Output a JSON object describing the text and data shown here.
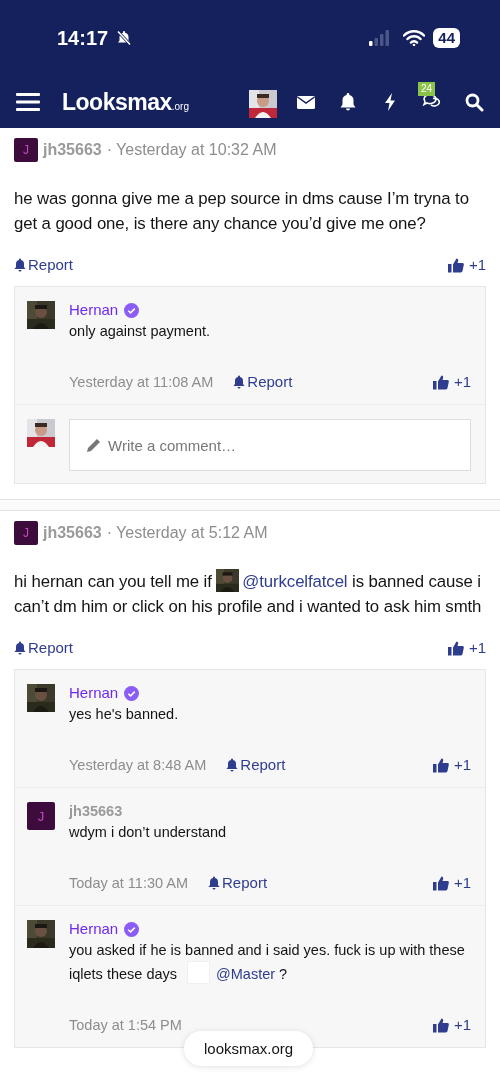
{
  "status_bar": {
    "time": "14:17",
    "battery": "44"
  },
  "header": {
    "logo": "Looksmax",
    "logo_suffix": ".org",
    "chat_badge": "24"
  },
  "posts": [
    {
      "author": "jh35663",
      "avatar_letter": "J",
      "separator": "·",
      "time": "Yesterday at 10:32 AM",
      "body": [
        {
          "kind": "text",
          "text": "he was gonna give me a pep source in dms cause I’m tryna to get a good one, is there any chance you’d give me one?"
        }
      ],
      "report": "Report",
      "likes": "+1",
      "comments": [
        {
          "author": "Hernan",
          "verified": true,
          "body": [
            {
              "kind": "text",
              "text": "only against payment."
            }
          ],
          "time": "Yesterday at 11:08 AM",
          "report": "Report",
          "likes": "+1"
        }
      ],
      "composer": {
        "placeholder": "Write a comment…"
      }
    },
    {
      "author": "jh35663",
      "avatar_letter": "J",
      "separator": "·",
      "time": "Yesterday at 5:12 AM",
      "body": [
        {
          "kind": "text",
          "text": "hi hernan can you tell me if "
        },
        {
          "kind": "avatar_picture"
        },
        {
          "kind": "mention",
          "text": "@turkcelfatcel"
        },
        {
          "kind": "text",
          "text": " is banned cause i can’t dm him or click on his profile and i wanted to ask him smth"
        }
      ],
      "report": "Report",
      "likes": "+1",
      "comments": [
        {
          "author": "Hernan",
          "verified": true,
          "body": [
            {
              "kind": "text",
              "text": "yes he's banned."
            }
          ],
          "time": "Yesterday at 8:48 AM",
          "report": "Report",
          "likes": "+1"
        },
        {
          "author": "jh35663",
          "verified": false,
          "avatar_letter": "J",
          "body": [
            {
              "kind": "text",
              "text": "wdym i don’t understand"
            }
          ],
          "time": "Today at 11:30 AM",
          "report": "Report",
          "likes": "+1"
        },
        {
          "author": "Hernan",
          "verified": true,
          "body": [
            {
              "kind": "text",
              "text": "you asked if he is banned and i said yes. fuck is up with these iqlets these days "
            },
            {
              "kind": "avatar_blank"
            },
            {
              "kind": "mention",
              "text": "@Master"
            },
            {
              "kind": "text",
              "text": " ?"
            }
          ],
          "time": "Today at 1:54 PM",
          "likes": "+1"
        }
      ]
    }
  ],
  "url_pill": "looksmax.org"
}
